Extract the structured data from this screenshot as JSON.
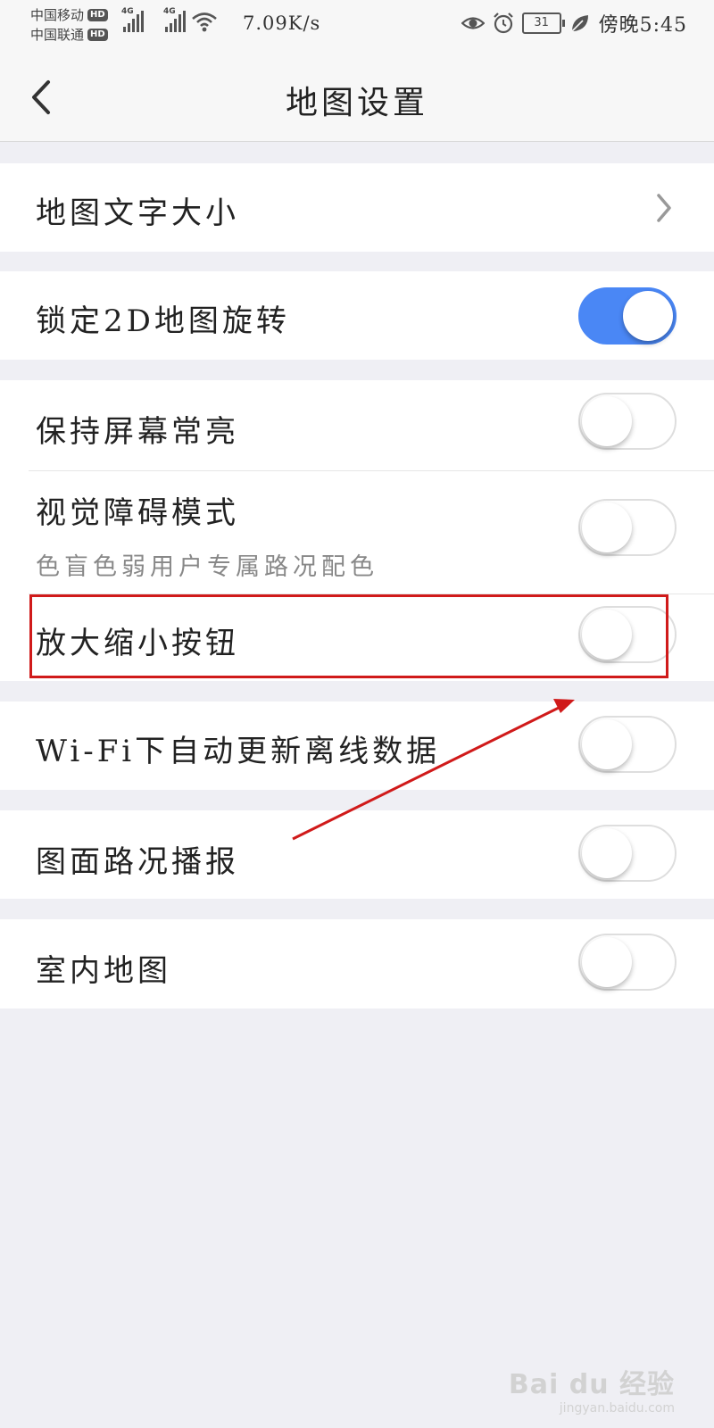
{
  "status_bar": {
    "carrier_1": "中国移动",
    "carrier_2": "中国联通",
    "hd_label": "HD",
    "network_1": "4G",
    "network_2": "4G",
    "net_speed": "7.09K/s",
    "battery": "31",
    "time": "傍晚5:45"
  },
  "header": {
    "title": "地图设置"
  },
  "settings": {
    "text_size": {
      "label": "地图文字大小"
    },
    "lock_2d_rotation": {
      "label": "锁定2D地图旋转",
      "enabled": true
    },
    "keep_screen_on": {
      "label": "保持屏幕常亮",
      "enabled": false
    },
    "visual_impairment": {
      "label": "视觉障碍模式",
      "subtitle": "色盲色弱用户专属路况配色",
      "enabled": false
    },
    "zoom_buttons": {
      "label": "放大缩小按钮",
      "enabled": false
    },
    "wifi_offline_update": {
      "label": "Wi-Fi下自动更新离线数据",
      "enabled": false
    },
    "traffic_broadcast": {
      "label": "图面路况播报",
      "enabled": false
    },
    "indoor_map": {
      "label": "室内地图",
      "enabled": false
    }
  },
  "colors": {
    "toggle_on": "#4a87f5",
    "annotation": "#d01a1a",
    "background": "#efeff4"
  },
  "watermark": {
    "logo": "Bai du 经验",
    "url": "jingyan.baidu.com"
  }
}
